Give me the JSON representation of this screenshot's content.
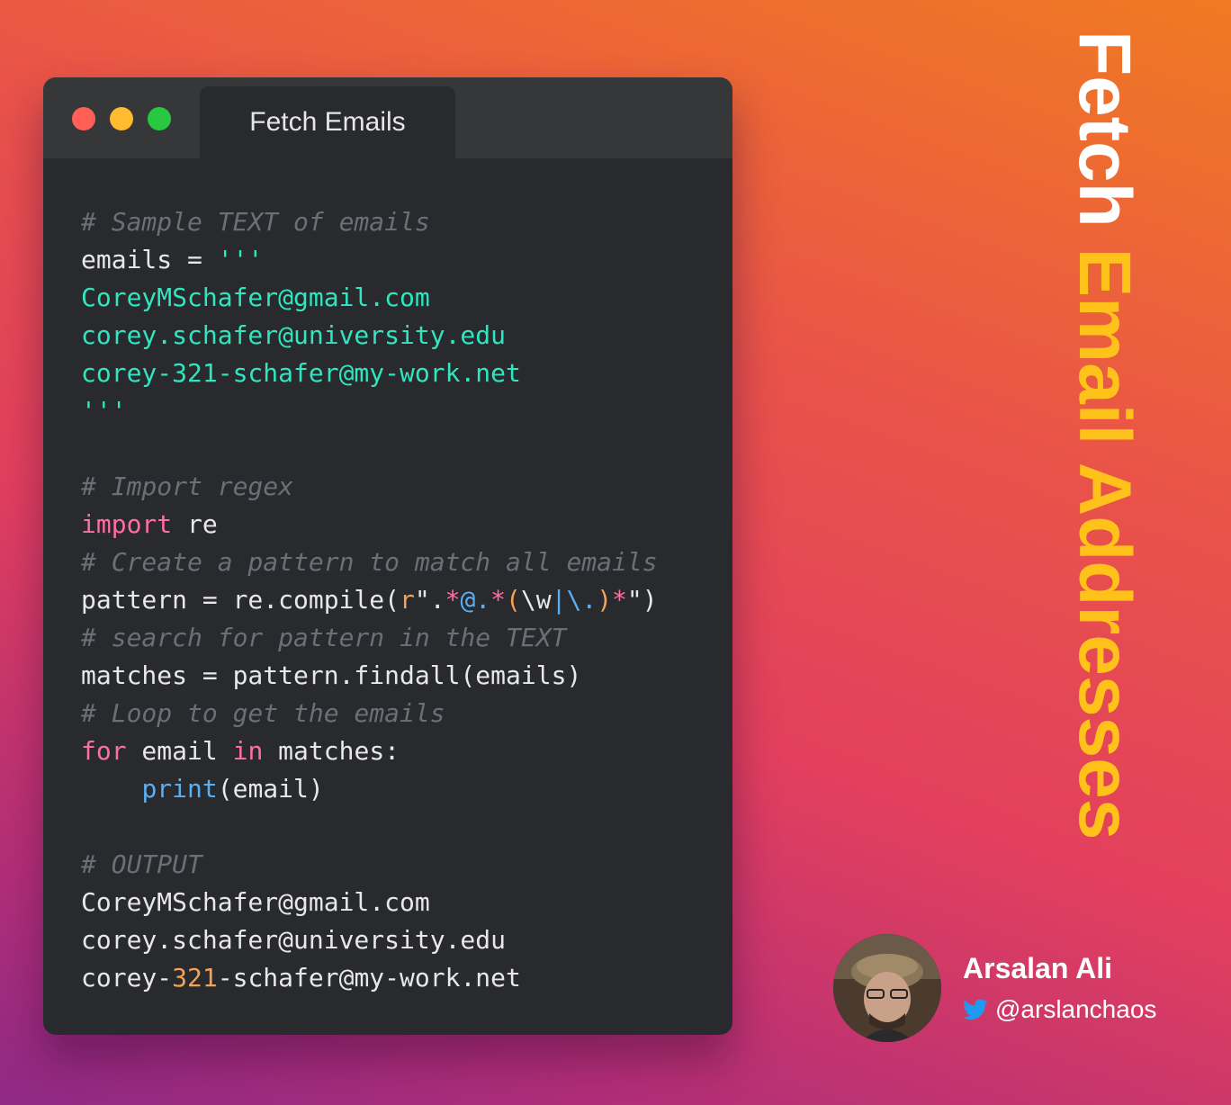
{
  "window": {
    "tab_title": "Fetch Emails",
    "traffic_lights": [
      "close",
      "minimize",
      "maximize"
    ]
  },
  "code_lines": [
    [
      {
        "t": "# Sample TEXT of emails",
        "c": "cm"
      }
    ],
    [
      {
        "t": "emails = ",
        "c": "pl"
      },
      {
        "t": "'''",
        "c": "str"
      }
    ],
    [
      {
        "t": "CoreyMSchafer@gmail.com",
        "c": "str"
      }
    ],
    [
      {
        "t": "corey.schafer@university.edu",
        "c": "str"
      }
    ],
    [
      {
        "t": "corey-321-schafer@my-work.net",
        "c": "str"
      }
    ],
    [
      {
        "t": "'''",
        "c": "str"
      }
    ],
    [],
    [
      {
        "t": "# Import regex",
        "c": "cm"
      }
    ],
    [
      {
        "t": "import",
        "c": "kw"
      },
      {
        "t": " re",
        "c": "pl"
      }
    ],
    [
      {
        "t": "# Create a pattern to match all emails",
        "c": "cm"
      }
    ],
    [
      {
        "t": "pattern = re.compile(",
        "c": "pl"
      },
      {
        "t": "r",
        "c": "org"
      },
      {
        "t": "\".",
        "c": "pl"
      },
      {
        "t": "*",
        "c": "rx"
      },
      {
        "t": "@.",
        "c": "fn"
      },
      {
        "t": "*",
        "c": "rx"
      },
      {
        "t": "(",
        "c": "org"
      },
      {
        "t": "\\w",
        "c": "pl"
      },
      {
        "t": "|",
        "c": "fn"
      },
      {
        "t": "\\.",
        "c": "fn"
      },
      {
        "t": ")",
        "c": "org"
      },
      {
        "t": "*",
        "c": "rx"
      },
      {
        "t": "\")",
        "c": "pl"
      }
    ],
    [
      {
        "t": "# search for pattern in the TEXT",
        "c": "cm"
      }
    ],
    [
      {
        "t": "matches = pattern.findall(emails)",
        "c": "pl"
      }
    ],
    [
      {
        "t": "# Loop to get the emails",
        "c": "cm"
      }
    ],
    [
      {
        "t": "for",
        "c": "kw"
      },
      {
        "t": " email ",
        "c": "pl"
      },
      {
        "t": "in",
        "c": "kw"
      },
      {
        "t": " matches:",
        "c": "pl"
      }
    ],
    [
      {
        "t": "    ",
        "c": "pl"
      },
      {
        "t": "print",
        "c": "fn"
      },
      {
        "t": "(email)",
        "c": "pl"
      }
    ],
    [],
    [
      {
        "t": "# OUTPUT",
        "c": "cm"
      }
    ],
    [
      {
        "t": "CoreyMSchafer@gmail.com",
        "c": "pl"
      }
    ],
    [
      {
        "t": "corey.schafer@university.edu",
        "c": "pl"
      }
    ],
    [
      {
        "t": "corey-",
        "c": "pl"
      },
      {
        "t": "321",
        "c": "org"
      },
      {
        "t": "-schafer@my-work.net",
        "c": "pl"
      }
    ]
  ],
  "side_title": {
    "word1": "Fetch ",
    "word2": "Email Addresses"
  },
  "author": {
    "name": "Arsalan Ali",
    "handle": "@arslanchaos",
    "handle_icon": "twitter-icon",
    "avatar": "avatar-photo"
  },
  "colors": {
    "window_bg": "#282a2d",
    "titlebar_bg": "#363738",
    "comment": "#6b6f76",
    "string": "#2fe6c0",
    "keyword": "#ff6ea3",
    "function": "#5aaef2",
    "number": "#f2a355",
    "accent_title": "#ffc21a",
    "twitter_blue": "#1d9bf0"
  }
}
